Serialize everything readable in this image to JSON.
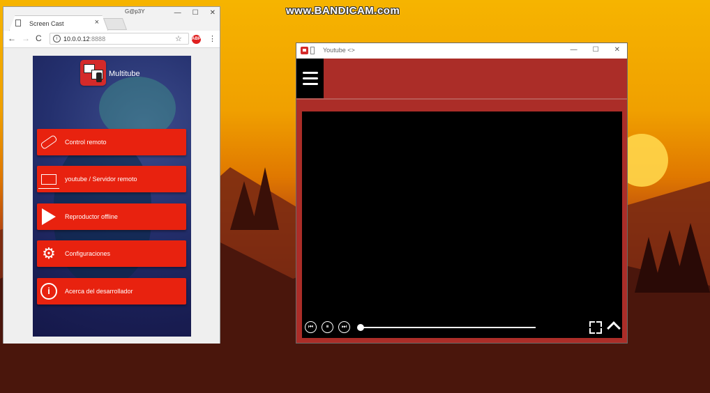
{
  "watermark": "www.BANDICAM.com",
  "browser": {
    "tab_title": "Screen Cast",
    "tab_close": "×",
    "profile_badge": "G@p3Y",
    "win_minimize": "—",
    "win_maximize": "☐",
    "win_close": "✕",
    "nav_back": "←",
    "nav_forward": "→",
    "nav_reload": "C",
    "url_host": "10.0.0.12",
    "url_port": ":8888",
    "info_glyph": "i",
    "star_glyph": "☆",
    "extension_label": "ABP",
    "menu_glyph": "⋮"
  },
  "app": {
    "name": "Multitube",
    "menu_items": [
      {
        "label": "Control remoto",
        "icon": "remote-icon"
      },
      {
        "label": "youtube / Servidor remoto",
        "icon": "monitor-play-icon"
      },
      {
        "label": "Reproductor offline",
        "icon": "play-icon"
      },
      {
        "label": "Configuraciones",
        "icon": "gear-icon"
      },
      {
        "label": "Acerca del desarrollador",
        "icon": "info-icon"
      }
    ],
    "gear_glyph": "⚙",
    "info_glyph": "i"
  },
  "youtube_window": {
    "title": "Youtube <>",
    "win_minimize": "—",
    "win_maximize": "☐",
    "win_close": "✕"
  },
  "player": {
    "prev_glyph": "⏮",
    "pause_glyph": "⏸",
    "next_glyph": "⏭",
    "progress": 0.0
  },
  "colors": {
    "accent_red": "#e8220f",
    "window_red": "#ab2d28",
    "app_bg": "#1a1f55"
  }
}
